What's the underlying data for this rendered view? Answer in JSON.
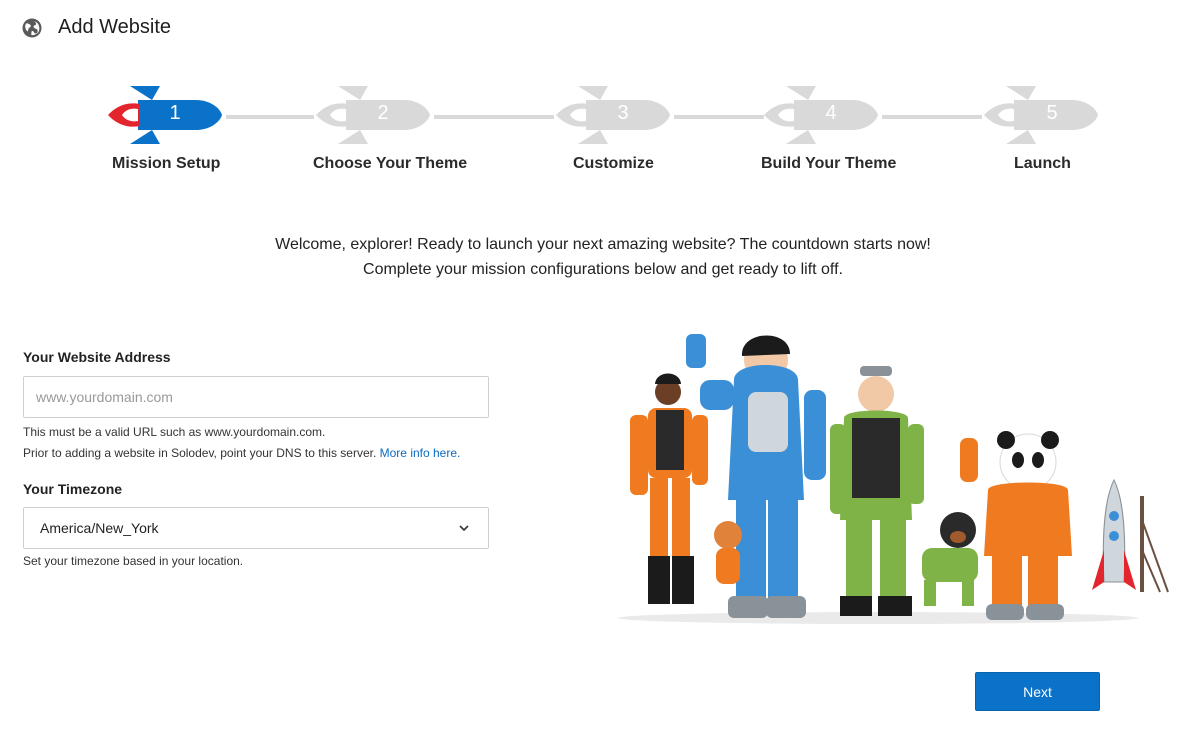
{
  "header": {
    "title": "Add Website",
    "icon": "globe-icon"
  },
  "steps": [
    {
      "number": "1",
      "label": "Mission Setup",
      "active": true
    },
    {
      "number": "2",
      "label": "Choose Your Theme",
      "active": false
    },
    {
      "number": "3",
      "label": "Customize",
      "active": false
    },
    {
      "number": "4",
      "label": "Build Your Theme",
      "active": false
    },
    {
      "number": "5",
      "label": "Launch",
      "active": false
    }
  ],
  "intro": {
    "line1": "Welcome, explorer! Ready to launch your next amazing website? The countdown starts now!",
    "line2": "Complete your mission configurations below and get ready to lift off."
  },
  "website": {
    "label": "Your Website Address",
    "placeholder": "www.yourdomain.com",
    "value": "",
    "help1": "This must be a valid URL such as www.yourdomain.com.",
    "help2": "Prior to adding a website in Solodev, point your DNS to this server.",
    "help_link": "More info here."
  },
  "timezone": {
    "label": "Your Timezone",
    "value": "America/New_York",
    "help": "Set your timezone based in your location."
  },
  "actions": {
    "next_label": "Next"
  },
  "colors": {
    "accent": "#0a73c9",
    "inactive": "#d9d9d9",
    "rocket_fin": "#e3262e"
  }
}
